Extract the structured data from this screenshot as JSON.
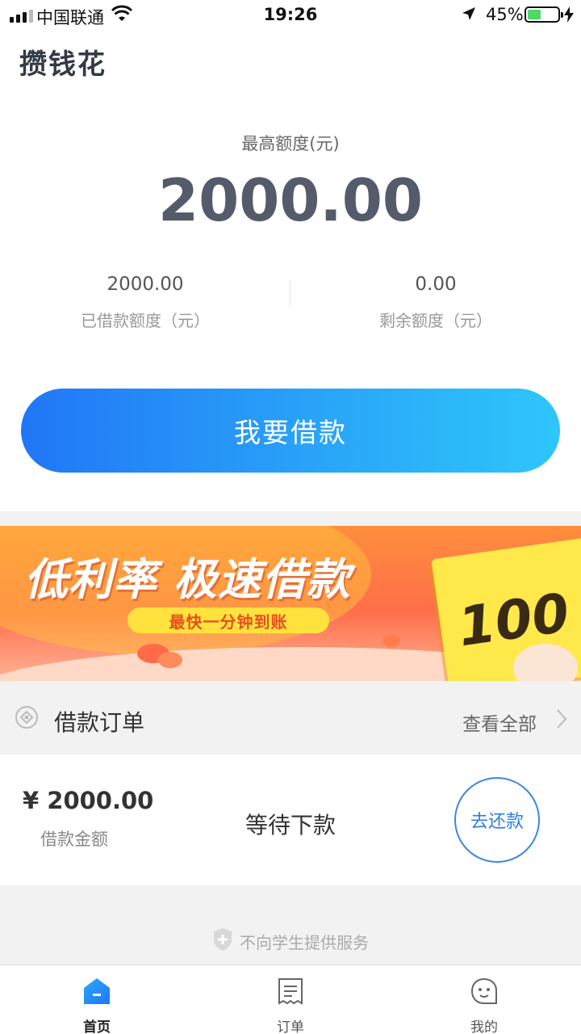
{
  "status_bar": {
    "carrier": "中国联通",
    "time": "19:26",
    "battery": "45%",
    "battery_level": 0.45,
    "icons": [
      "signal-icon",
      "wifi-icon",
      "location-arrow-icon",
      "battery-icon",
      "charging-bolt-icon"
    ]
  },
  "header": {
    "app_name": "攒钱花"
  },
  "credit": {
    "max_label": "最高额度(元)",
    "max_value": "2000.00",
    "borrowed_value": "2000.00",
    "borrowed_label": "已借款额度（元）",
    "remaining_value": "0.00",
    "remaining_label": "剩余额度（元）"
  },
  "borrow_button": {
    "label": "我要借款"
  },
  "banner": {
    "headline": "低利率 极速借款",
    "pill": "最快一分钟到账",
    "ticket": "100",
    "colors": {
      "start": "#ff8e3c",
      "end": "#ffb395",
      "pill": "#ffe23d"
    }
  },
  "orders": {
    "title": "借款订单",
    "view_all": "查看全部",
    "item": {
      "amount": "¥ 2000.00",
      "amount_label": "借款金额",
      "status": "等待下款",
      "repay_label": "去还款"
    }
  },
  "notice": {
    "text": "不向学生提供服务"
  },
  "tabbar": {
    "items": [
      {
        "label": "首页",
        "icon": "home-icon",
        "active": true
      },
      {
        "label": "订单",
        "icon": "orders-icon",
        "active": false
      },
      {
        "label": "我的",
        "icon": "profile-icon",
        "active": false
      }
    ]
  },
  "colors": {
    "accent": "#2176f6",
    "accent_end": "#2ec6fb",
    "repay": "#2f7de0",
    "text_dark": "#545b6a"
  }
}
